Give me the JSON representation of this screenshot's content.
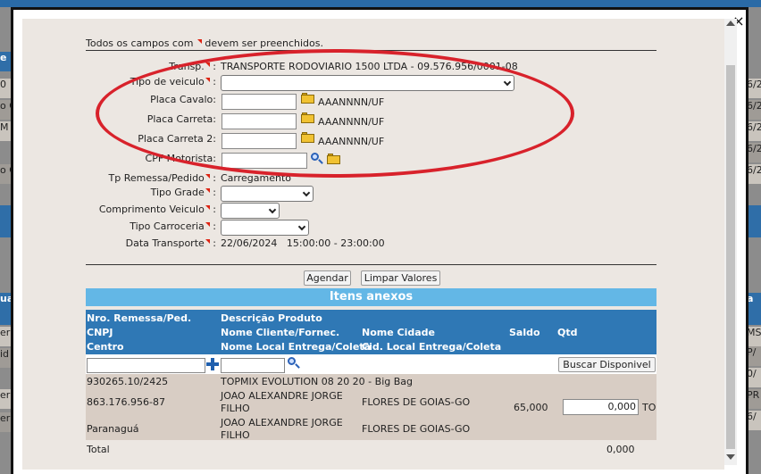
{
  "background": {
    "left_rows": [
      "e",
      "0",
      "o C",
      "M",
      "o C",
      "ua",
      "er",
      "id",
      "er",
      "er"
    ],
    "right_rows": [
      "6/2",
      "6/2",
      "6/2",
      "6/2",
      "6/2",
      "a",
      "MS",
      "P/",
      "0/",
      "PR",
      "6/",
      "6/"
    ]
  },
  "modal": {
    "close_label": "×",
    "required_note_prefix": "Todos os campos com",
    "required_note_suffix": "devem ser preenchidos.",
    "form": {
      "transp_label": "Transp.",
      "transp_value": "TRANSPORTE RODOVIARIO 1500 LTDA - 09.576.956/0001-08",
      "tipo_veiculo_label": "Tipo de veiculo",
      "tipo_veiculo_value": "",
      "placa_cavalo_label": "Placa Cavalo:",
      "placa_cavalo_value": "",
      "placa_cavalo_hint": "AAANNNN/UF",
      "placa_carreta_label": "Placa Carreta:",
      "placa_carreta_value": "",
      "placa_carreta_hint": "AAANNNN/UF",
      "placa_carreta2_label": "Placa Carreta 2:",
      "placa_carreta2_value": "",
      "placa_carreta2_hint": "AAANNNN/UF",
      "cpf_label": "CPF Motorista:",
      "cpf_value": "",
      "tp_remessa_label": "Tp Remessa/Pedido",
      "tp_remessa_value": "Carregamento",
      "tipo_grade_label": "Tipo Grade",
      "tipo_grade_value": "",
      "comprimento_label": "Comprimento Veiculo",
      "comprimento_value": "",
      "tipo_carroceria_label": "Tipo Carroceria",
      "tipo_carroceria_value": "",
      "data_transporte_label": "Data Transporte",
      "data_transporte_value": "22/06/2024   15:00:00 - 23:00:00"
    },
    "buttons": {
      "agendar": "Agendar",
      "limpar": "Limpar Valores",
      "buscar": "Buscar Disponivel"
    },
    "itens": {
      "title": "Itens anexos",
      "headers": {
        "col1": [
          "Nro. Remessa/Ped.",
          "CNPJ",
          "Centro"
        ],
        "col2": [
          "Descrição Produto",
          "Nome Cliente/Fornec.",
          "Nome Local Entrega/Coleta"
        ],
        "col3": [
          "Nome Cidade",
          "Cid. Local Entrega/Coleta"
        ],
        "saldo": "Saldo",
        "qtd": "Qtd"
      },
      "filter": {
        "remessa": "",
        "produto": ""
      },
      "row": {
        "remessa": "930265.10/2425",
        "produto": "TOPMIX EVOLUTION 08 20 20 - Big Bag",
        "cnpj": "863.176.956-87",
        "cliente_line1": "JOAO ALEXANDRE JORGE",
        "cliente_line2": "FILHO",
        "cidade": "FLORES DE GOIAS-GO",
        "saldo": "65,000",
        "qtd": "0,000",
        "unidade": "TO",
        "centro": "Paranaguá",
        "local_line1": "JOAO ALEXANDRE JORGE",
        "local_line2": "FILHO",
        "cid_local": "FLORES DE GOIAS-GO"
      },
      "total_label": "Total",
      "total_value": "0,000"
    }
  },
  "colors": {
    "header_blue": "#2f78b5",
    "section_blue": "#63b7e6",
    "highlight_red": "#d8222b",
    "required_red": "#d21"
  }
}
